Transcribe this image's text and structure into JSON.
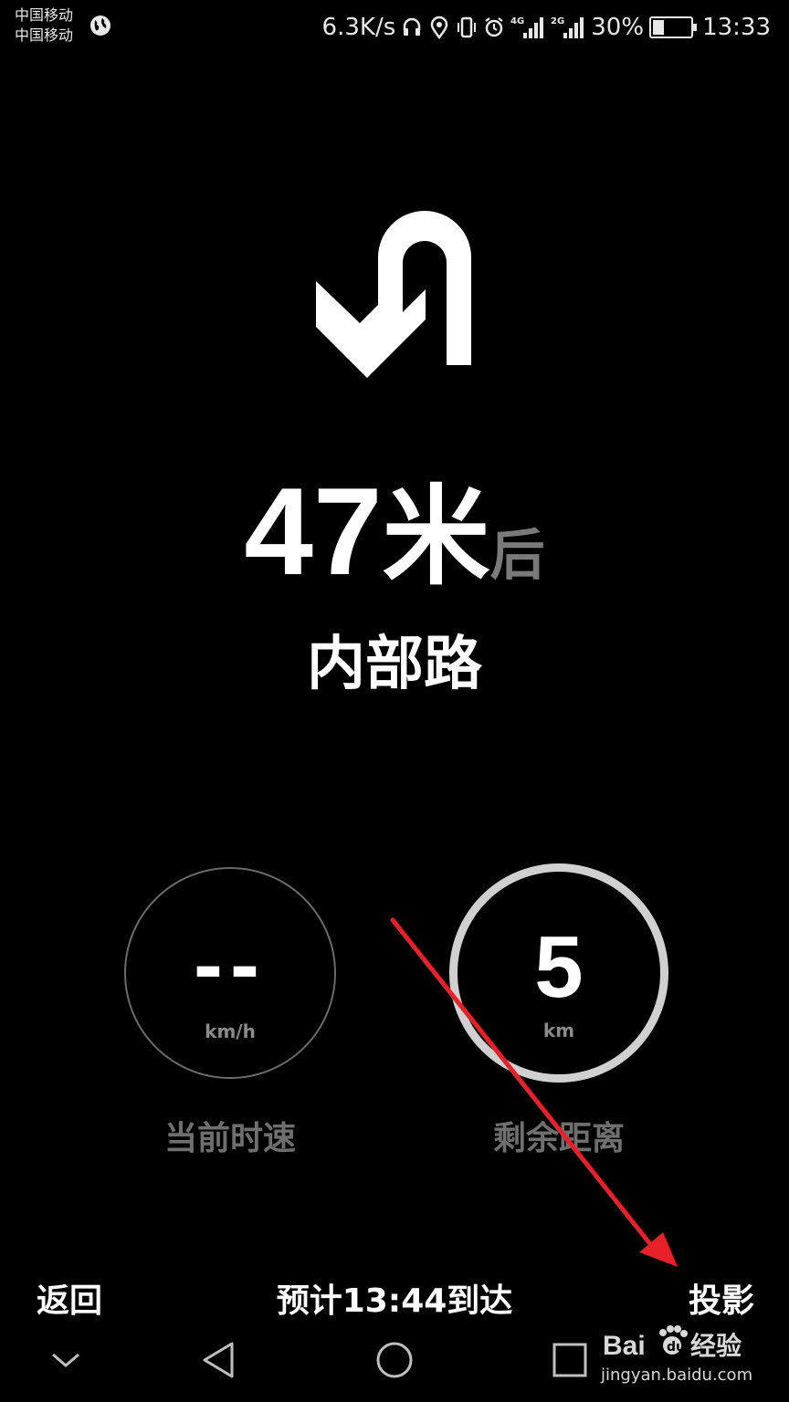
{
  "status_bar": {
    "carrier_1": "中国移动",
    "carrier_2": "中国移动",
    "net_speed": "6.3K/s",
    "signal_1_label": "4G",
    "signal_2_label": "2G",
    "battery_percent": "30%",
    "battery_level": 0.3,
    "time": "13:33"
  },
  "navigation": {
    "turn_icon": "u-turn-left-icon",
    "distance_value": "47",
    "distance_unit": "米",
    "distance_suffix": "后",
    "road_name": "内部路"
  },
  "gauges": {
    "speed": {
      "value": "--",
      "unit": "km/h",
      "label": "当前时速"
    },
    "remaining": {
      "value": "5",
      "unit": "km",
      "label": "剩余距离"
    }
  },
  "bottom_bar": {
    "back_label": "返回",
    "eta_label": "预计13:44到达",
    "project_label": "投影"
  },
  "system_nav": [
    "chevron-down-icon",
    "back-triangle-icon",
    "home-circle-icon",
    "recents-square-icon"
  ],
  "watermark": {
    "brand": "Bai",
    "brand_cn": "经验",
    "url": "jingyan.baidu.com"
  },
  "colors": {
    "background": "#000000",
    "text": "#ffffff",
    "muted": "#6f6f6f",
    "annotation_arrow": "#e8202a"
  }
}
